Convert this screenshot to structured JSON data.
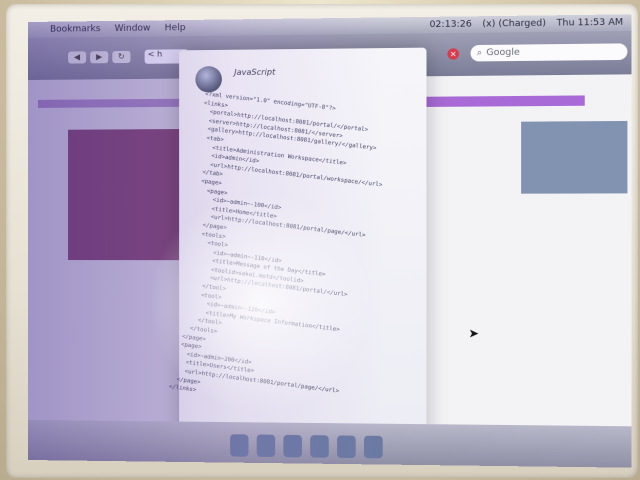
{
  "menubar": {
    "apple": "",
    "items": [
      "Bookmarks",
      "Window",
      "Help"
    ],
    "status_time": "02:13:26",
    "battery": "(x) (Charged)",
    "clock": "Thu 11:53 AM"
  },
  "browser": {
    "url_stub": "< h",
    "search_placeholder": "Google",
    "stop_label": "×"
  },
  "overlay": {
    "title": "JavaScript",
    "code_lines": [
      "<?xml version=\"1.0\" encoding=\"UTF-8\"?>",
      "<links>",
      "  <portal>http://localhost:8081/portal/</portal>",
      "  <server>http://localhost:8081/</server>",
      "  <gallery>http://localhost:8081/gallery/</gallery>",
      "  <tab>",
      "    <title>Administration Workspace</title>",
      "    <id>admin</id>",
      "    <url>http://localhost:8081/portal/workspace/</url>",
      "  </tab>",
      "  <page>",
      "    <page>",
      "      <id>~admin~-100</id>",
      "      <title>Home</title>",
      "      <url>http://localhost:8081/portal/page/</url>",
      "    </page>",
      "    <tools>",
      "      <tool>",
      "        <id>~admin~-110</id>",
      "        <title>Message of the Day</title>",
      "        <toolid>sakai.motd</toolid>",
      "        <url>http://localhost:8081/portal/</url>",
      "      </tool>",
      "      <tool>",
      "        <id>~admin~-120</id>",
      "        <title>My Workspace Information</title>",
      "      </tool>",
      "    </tools>",
      "  </page>",
      "  <page>",
      "    <id>~admin~200</id>",
      "    <title>Users</title>",
      "    <url>http://localhost:8081/portal/page/</url>",
      "  </page>",
      "</links>"
    ]
  },
  "dock": {
    "icons": [
      "finder-icon",
      "mail-icon",
      "music-icon",
      "pencil-icon",
      "app-icon",
      "star-icon"
    ]
  }
}
